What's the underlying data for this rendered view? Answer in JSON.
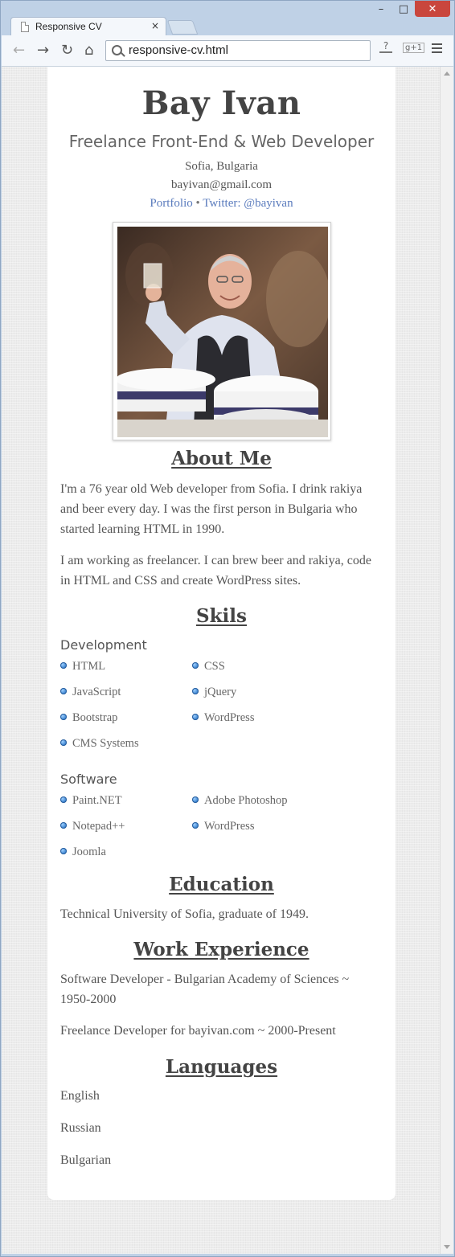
{
  "browser": {
    "tab_title": "Responsive CV",
    "tab_close": "×",
    "url": "responsive-cv.html",
    "nav": {
      "back": "←",
      "forward": "→",
      "reload": "↻",
      "home": "⌂"
    },
    "window_controls": {
      "minimize": "–",
      "maximize": "□",
      "close": "✕"
    },
    "toolbar_icons": {
      "extension": "?",
      "gplus": "g+1"
    },
    "icons": [
      "page-icon",
      "search-icon",
      "menu-icon"
    ]
  },
  "cv": {
    "name": "Bay Ivan",
    "role": "Freelance Front-End & Web Developer",
    "location": "Sofia, Bulgaria",
    "email": "bayivan@gmail.com",
    "portfolio_label": "Portfolio",
    "separator": "•",
    "twitter_label": "Twitter: @bayivan",
    "about": {
      "title": "About Me",
      "p1": "I'm a 76 year old Web developer from Sofia. I drink rakiya and beer every day. I was the first person in Bulgaria who started learning HTML in 1990.",
      "p2": "I am working as freelancer. I can brew beer and rakiya, code in HTML and CSS and create WordPress sites."
    },
    "skills": {
      "title": "Skils",
      "development": {
        "heading": "Development",
        "items": [
          "HTML",
          "CSS",
          "JavaScript",
          "jQuery",
          "Bootstrap",
          "WordPress",
          "CMS Systems"
        ]
      },
      "software": {
        "heading": "Software",
        "items": [
          "Paint.NET",
          "Adobe Photoshop",
          "Notepad++",
          "WordPress",
          "Joomla"
        ]
      }
    },
    "education": {
      "title": "Education",
      "text": "Technical University of Sofia, graduate of 1949."
    },
    "work": {
      "title": "Work Experience",
      "items": [
        "Software Developer - Bulgarian Academy of Sciences ~ 1950-2000",
        "Freelance Developer for bayivan.com ~ 2000-Present"
      ]
    },
    "languages": {
      "title": "Languages",
      "items": [
        "English",
        "Russian",
        "Bulgarian"
      ]
    }
  }
}
